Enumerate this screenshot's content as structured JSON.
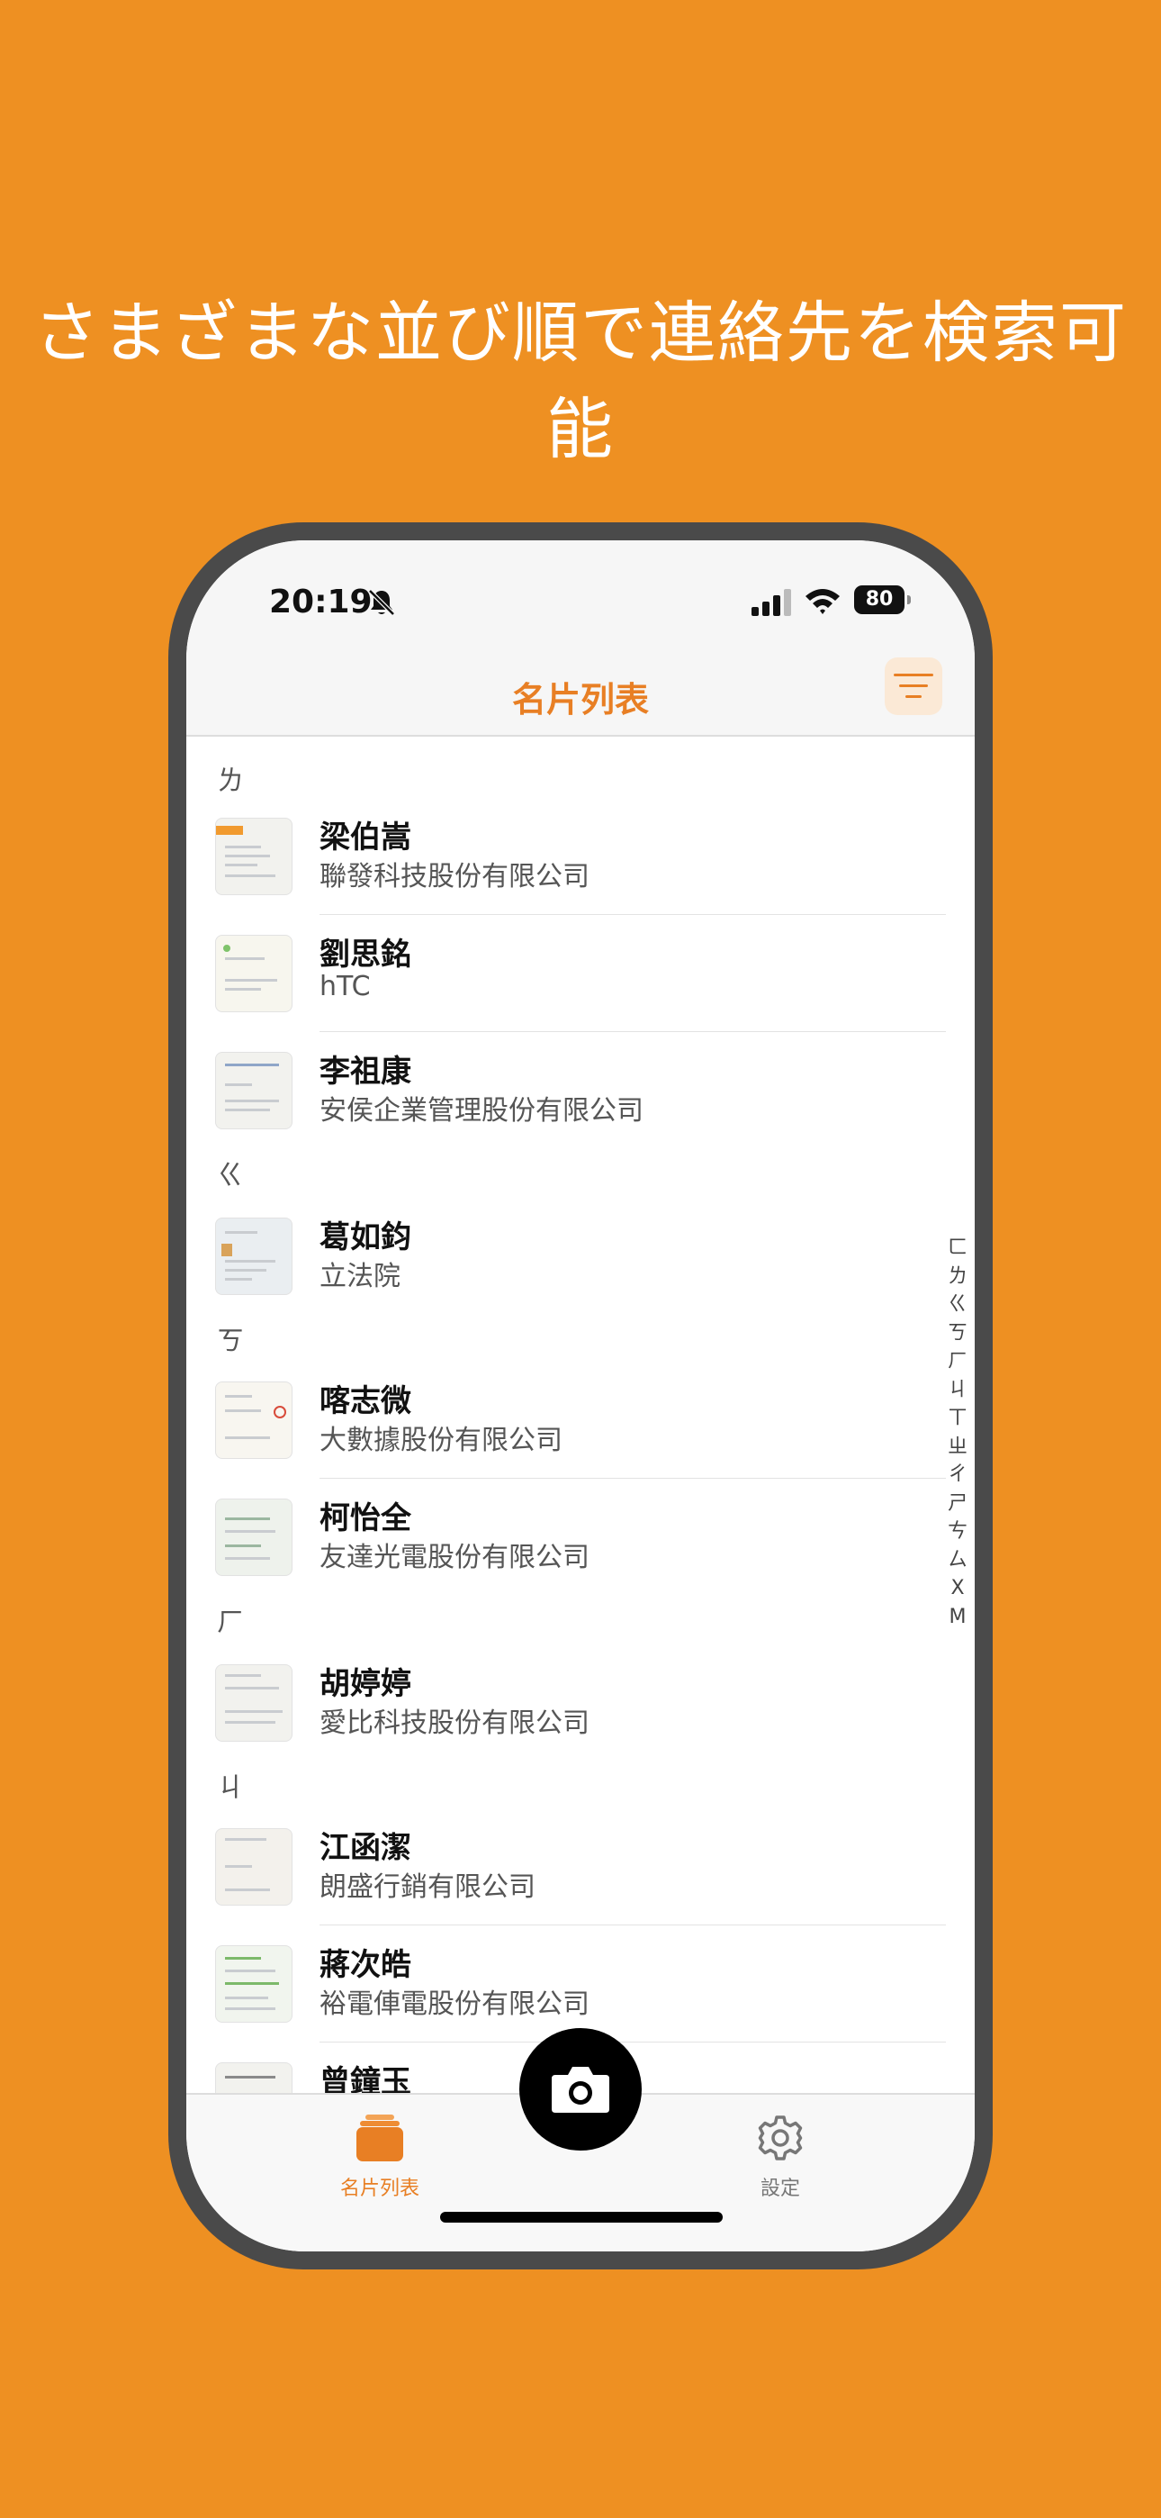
{
  "headline": "さまざまな並び順で連絡先を検索可能",
  "status_bar": {
    "time": "20:19",
    "battery": "80"
  },
  "nav": {
    "title": "名片列表"
  },
  "sections": [
    {
      "header": "ㄌ",
      "contacts": [
        {
          "name": "梁伯嵩",
          "company": "聯發科技股份有限公司"
        },
        {
          "name": "劉思銘",
          "company": "hTC"
        },
        {
          "name": "李祖康",
          "company": "安侯企業管理股份有限公司"
        }
      ]
    },
    {
      "header": "ㄍ",
      "contacts": [
        {
          "name": "葛如鈞",
          "company": "立法院"
        }
      ]
    },
    {
      "header": "ㄎ",
      "contacts": [
        {
          "name": "喀志微",
          "company": "大數據股份有限公司"
        },
        {
          "name": "柯怡全",
          "company": "友達光電股份有限公司"
        }
      ]
    },
    {
      "header": "ㄏ",
      "contacts": [
        {
          "name": "胡婷婷",
          "company": "愛比科技股份有限公司"
        }
      ]
    },
    {
      "header": "ㄐ",
      "contacts": [
        {
          "name": "江函潔",
          "company": "朗盛行銷有限公司"
        },
        {
          "name": "蔣次皓",
          "company": "裕電俥電股份有限公司"
        },
        {
          "name": "曾鐘玉",
          "company": ""
        }
      ]
    }
  ],
  "index_letters": [
    "ㄈ",
    "ㄌ",
    "ㄍ",
    "ㄎ",
    "ㄏ",
    "ㄐ",
    "ㄒ",
    "ㄓ",
    "ㄔ",
    "ㄕ",
    "ㄘ",
    "ㄙ",
    "X",
    "M"
  ],
  "tabs": {
    "cards": "名片列表",
    "settings": "設定"
  },
  "colors": {
    "background": "#EE9022",
    "accent": "#E87F24"
  }
}
